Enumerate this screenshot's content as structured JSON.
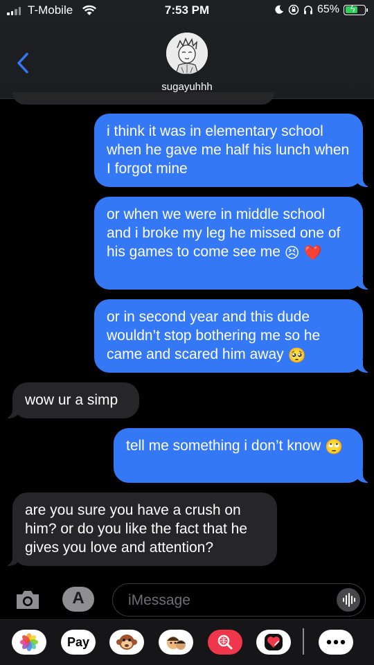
{
  "status_bar": {
    "carrier": "T-Mobile",
    "time": "7:53 PM",
    "battery": "65%"
  },
  "header": {
    "contact_name": "sugayuhhh"
  },
  "messages": [
    {
      "from": "me",
      "text": "i think it was in elementary school when he gave me half his lunch when I forgot mine"
    },
    {
      "from": "me",
      "text": "or when we were in middle school and i broke my leg he missed one of his games to come see me",
      "emoji": "😣",
      "emoji2": "❤️"
    },
    {
      "from": "me",
      "text": "or in second year and this dude wouldn’t stop bothering me so he came and scared him away",
      "emoji": "🥺"
    },
    {
      "from": "them",
      "text": "wow ur a simp"
    },
    {
      "from": "me",
      "text": "tell me something i don’t know",
      "emoji": "🙄"
    },
    {
      "from": "them",
      "text": "are you sure you have a crush on him? or do you like the fact that he gives you love and attention?"
    }
  ],
  "compose": {
    "placeholder": "iMessage"
  },
  "drawer": {
    "pay_label": "Pay",
    "apps": [
      "photos-icon",
      "apple-pay-icon",
      "memoji-monkey-icon",
      "memoji-icon",
      "web-search-icon",
      "digital-touch-icon",
      "more-icon"
    ]
  }
}
